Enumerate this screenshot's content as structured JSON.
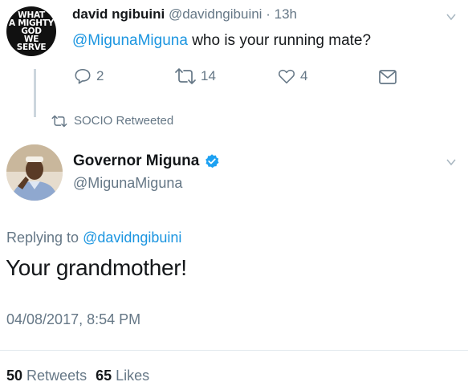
{
  "tweet1": {
    "avatar_text": [
      "WHAT",
      "A MIGHTY",
      "GOD",
      "WE",
      "SERVE"
    ],
    "author_name": "david ngibuini",
    "author_handle": "@davidngibuini",
    "separator": "·",
    "time": "13h",
    "mention": "@MigunaMiguna",
    "body": " who is your running mate?",
    "replies": "2",
    "retweets": "14",
    "likes": "4"
  },
  "retweet_banner": {
    "text": "SOCIO Retweeted"
  },
  "tweet2": {
    "author_name": "Governor Miguna",
    "author_handle": "@MigunaMiguna",
    "replying_prefix": "Replying to ",
    "replying_handle": "@davidngibuini",
    "body": "Your grandmother!",
    "timestamp": "04/08/2017, 8:54 PM",
    "retweet_count": "50",
    "retweet_label": "Retweets",
    "like_count": "65",
    "like_label": "Likes"
  },
  "colors": {
    "accent": "#1b95e0",
    "muted": "#657786",
    "text": "#14171a",
    "line": "#ccd6dd"
  }
}
